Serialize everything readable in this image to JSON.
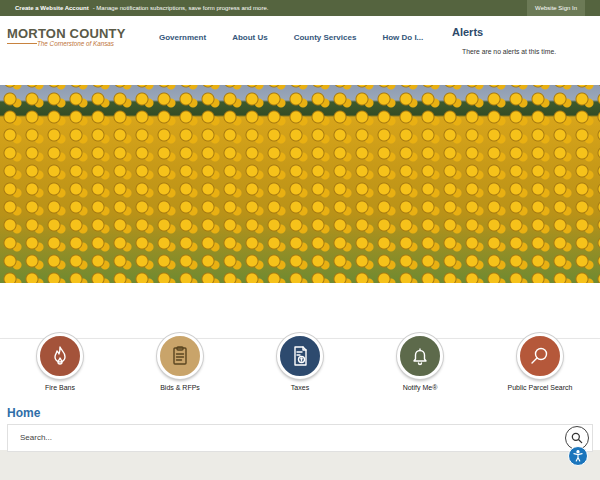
{
  "top_bar": {
    "account_link": "Create a Website Account",
    "message": "- Manage notification subscriptions, save form progress and more.",
    "sign_in": "Website Sign In"
  },
  "logo": {
    "title": "MORTON COUNTY",
    "tagline": "The Cornerstone of Kansas"
  },
  "nav": [
    "Government",
    "About Us",
    "County Services",
    "How Do I..."
  ],
  "alerts": {
    "title": "Alerts",
    "message": "There are no alerts at this time."
  },
  "quick_links": [
    {
      "label": "Fire Bans",
      "color": "#a4533a"
    },
    {
      "label": "Bids & RFPs",
      "color": "#c9a46a"
    },
    {
      "label": "Taxes",
      "color": "#2d4a6e"
    },
    {
      "label": "Notify Me®",
      "color": "#5d6a4b"
    },
    {
      "label": "Public Parcel Search",
      "color": "#b5583a"
    }
  ],
  "breadcrumb": "Home",
  "search": {
    "placeholder": "Search..."
  }
}
